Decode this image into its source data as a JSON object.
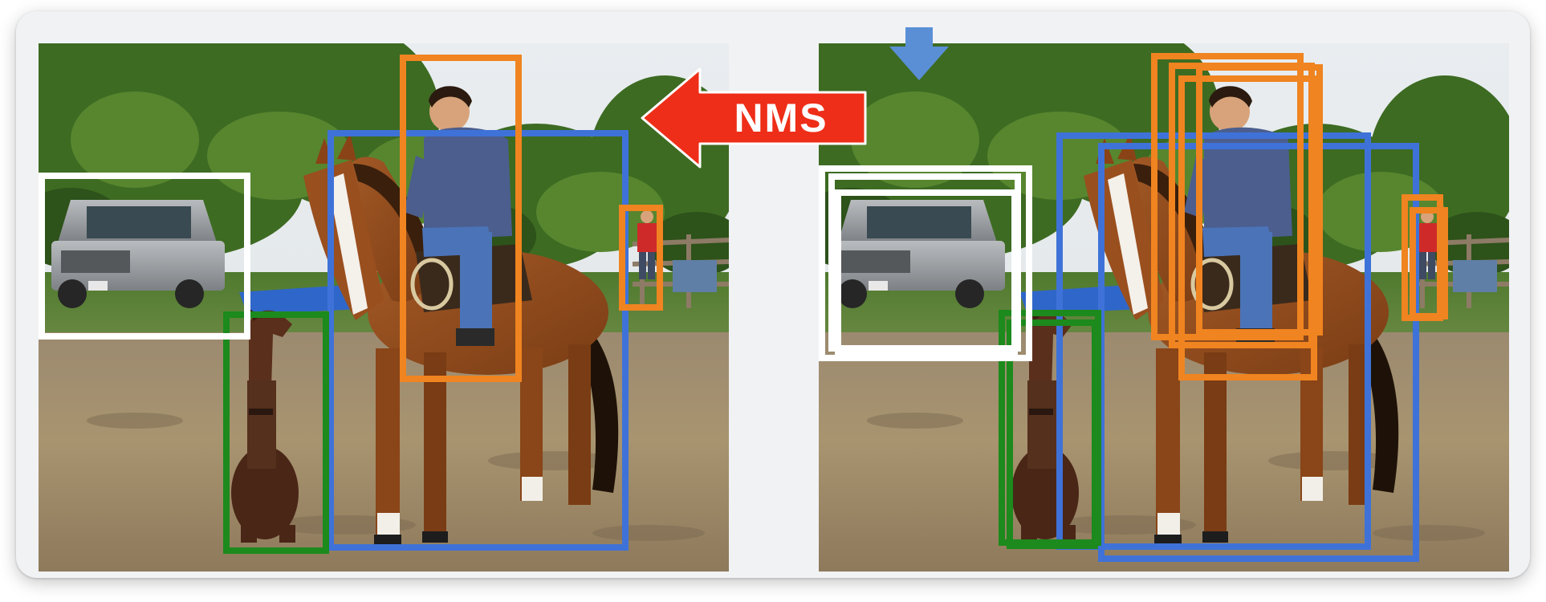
{
  "arrow_label": "NMS",
  "colors": {
    "nms_arrow": "#ee2e18",
    "down_arrow": "#5a8fd6",
    "box_blue": "#3f72d8",
    "box_orange": "#f08420",
    "box_green": "#1c8a1c",
    "box_white": "#ffffff"
  },
  "panels": [
    {
      "role": "after-nms",
      "detections": [
        {
          "object": "horse",
          "color": "blue"
        },
        {
          "object": "person",
          "color": "orange"
        },
        {
          "object": "person",
          "color": "orange"
        },
        {
          "object": "dog",
          "color": "green"
        },
        {
          "object": "car",
          "color": "white"
        }
      ]
    },
    {
      "role": "before-nms",
      "detections": [
        {
          "object": "horse",
          "color": "blue"
        },
        {
          "object": "horse",
          "color": "blue"
        },
        {
          "object": "person",
          "color": "orange"
        },
        {
          "object": "person",
          "color": "orange"
        },
        {
          "object": "person",
          "color": "orange"
        },
        {
          "object": "person",
          "color": "orange"
        },
        {
          "object": "person",
          "color": "orange"
        },
        {
          "object": "person",
          "color": "orange"
        },
        {
          "object": "dog",
          "color": "green"
        },
        {
          "object": "dog",
          "color": "green"
        },
        {
          "object": "car",
          "color": "white"
        },
        {
          "object": "car",
          "color": "white"
        },
        {
          "object": "car",
          "color": "white"
        }
      ]
    }
  ]
}
